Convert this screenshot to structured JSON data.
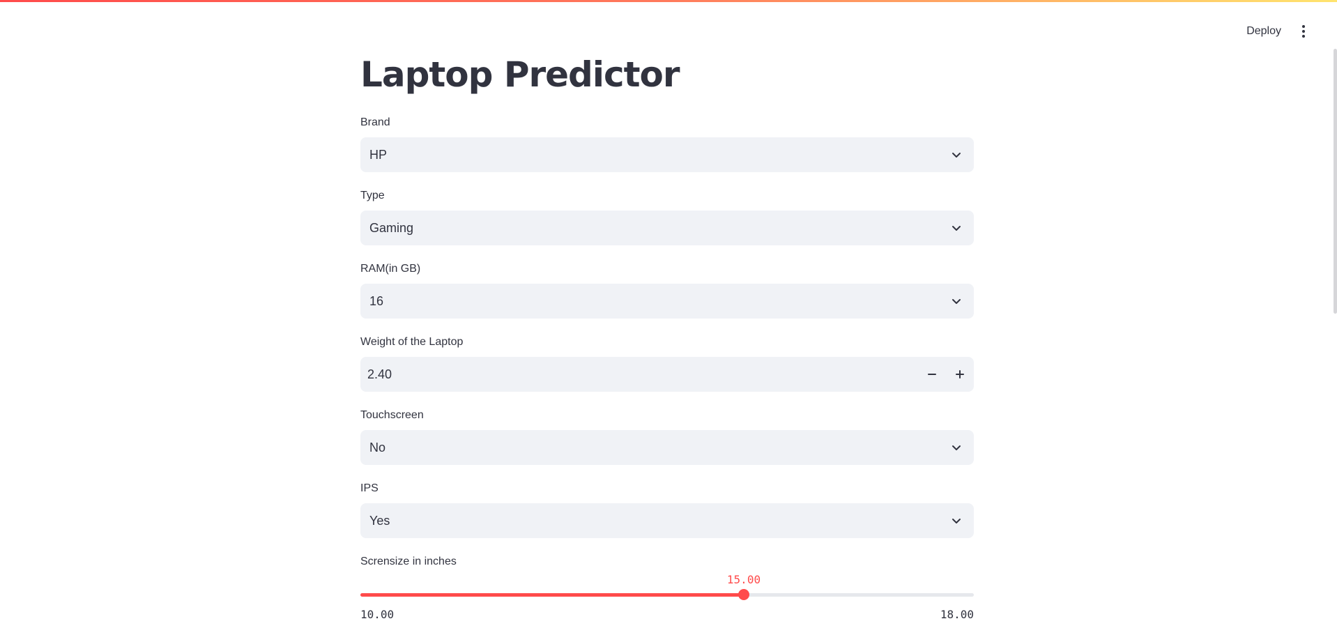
{
  "header": {
    "deploy_label": "Deploy",
    "menu_icon": "kebab-menu-icon"
  },
  "page": {
    "title": "Laptop Predictor"
  },
  "fields": {
    "brand": {
      "label": "Brand",
      "value": "HP"
    },
    "type": {
      "label": "Type",
      "value": "Gaming"
    },
    "ram": {
      "label": "RAM(in GB)",
      "value": "16"
    },
    "weight": {
      "label": "Weight of the Laptop",
      "value": "2.40"
    },
    "touchscreen": {
      "label": "Touchscreen",
      "value": "No"
    },
    "ips": {
      "label": "IPS",
      "value": "Yes"
    },
    "screensize": {
      "label": "Scrensize in inches",
      "value": 15.0,
      "value_label": "15.00",
      "min": 10.0,
      "max": 18.0,
      "min_label": "10.00",
      "max_label": "18.00"
    }
  },
  "colors": {
    "accent": "#ff4b4b",
    "input_bg": "#f0f2f6",
    "text": "#31333f"
  }
}
